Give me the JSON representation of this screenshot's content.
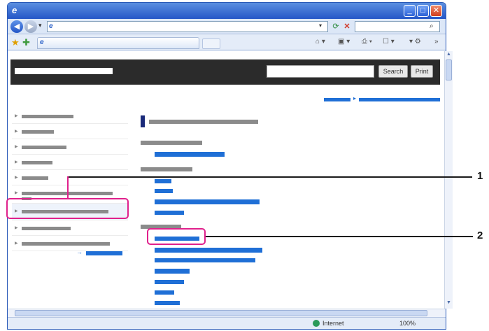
{
  "header": {
    "search_label": "Search",
    "print_label": "Print"
  },
  "status": {
    "zone": "Internet",
    "zoom": "100%"
  },
  "callouts": {
    "one": "1",
    "two": "2"
  },
  "icons": {
    "back": "back-arrow-icon",
    "forward": "forward-arrow-icon",
    "refresh": "refresh-icon",
    "stop": "stop-icon",
    "search": "search-icon",
    "favorites": "star-icon",
    "add_favorites": "add-favorite-icon"
  },
  "colors": {
    "highlight": "#e0208c",
    "link": "#1f6fd6",
    "header": "#2b2b2b"
  }
}
